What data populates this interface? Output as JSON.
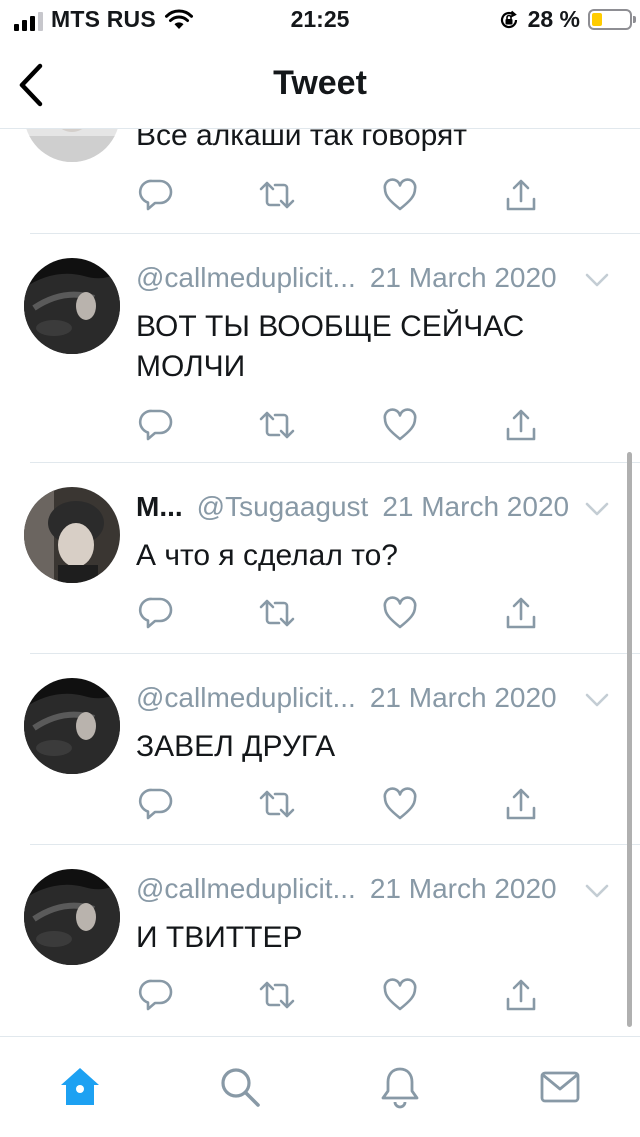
{
  "status_bar": {
    "carrier": "MTS RUS",
    "time": "21:25",
    "battery_percent": "28 %",
    "battery_level": 0.28,
    "battery_color": "#ffcc00"
  },
  "nav": {
    "title": "Tweet"
  },
  "top_tweet": {
    "text": "Все алкаши так говорят"
  },
  "tweets": [
    {
      "name": "",
      "handle": "@callmeduplicit...",
      "date": "21 March 2020",
      "text": "ВОТ ТЫ ВООБЩЕ СЕЙЧАС МОЛЧИ"
    },
    {
      "name": "М...",
      "handle": "@Tsugaagust",
      "date": "21 March 2020",
      "text": "А что я сделал то?"
    },
    {
      "name": "",
      "handle": "@callmeduplicit...",
      "date": "21 March 2020",
      "text": "ЗАВЕЛ ДРУГА"
    },
    {
      "name": "",
      "handle": "@callmeduplicit...",
      "date": "21 March 2020",
      "text": "И ТВИТТЕР"
    }
  ],
  "icons": {
    "reply": "reply-icon",
    "retweet": "retweet-icon",
    "like": "like-icon",
    "share": "share-icon"
  },
  "tab_bar": {
    "tabs": [
      "home-icon",
      "search-icon",
      "notifications-icon",
      "messages-icon"
    ],
    "active_color": "#1da1f2",
    "inactive_color": "#8899a6"
  },
  "colors": {
    "secondary_text": "#8899a6",
    "primary_text": "#14171a",
    "divider": "#e1e8ed"
  }
}
